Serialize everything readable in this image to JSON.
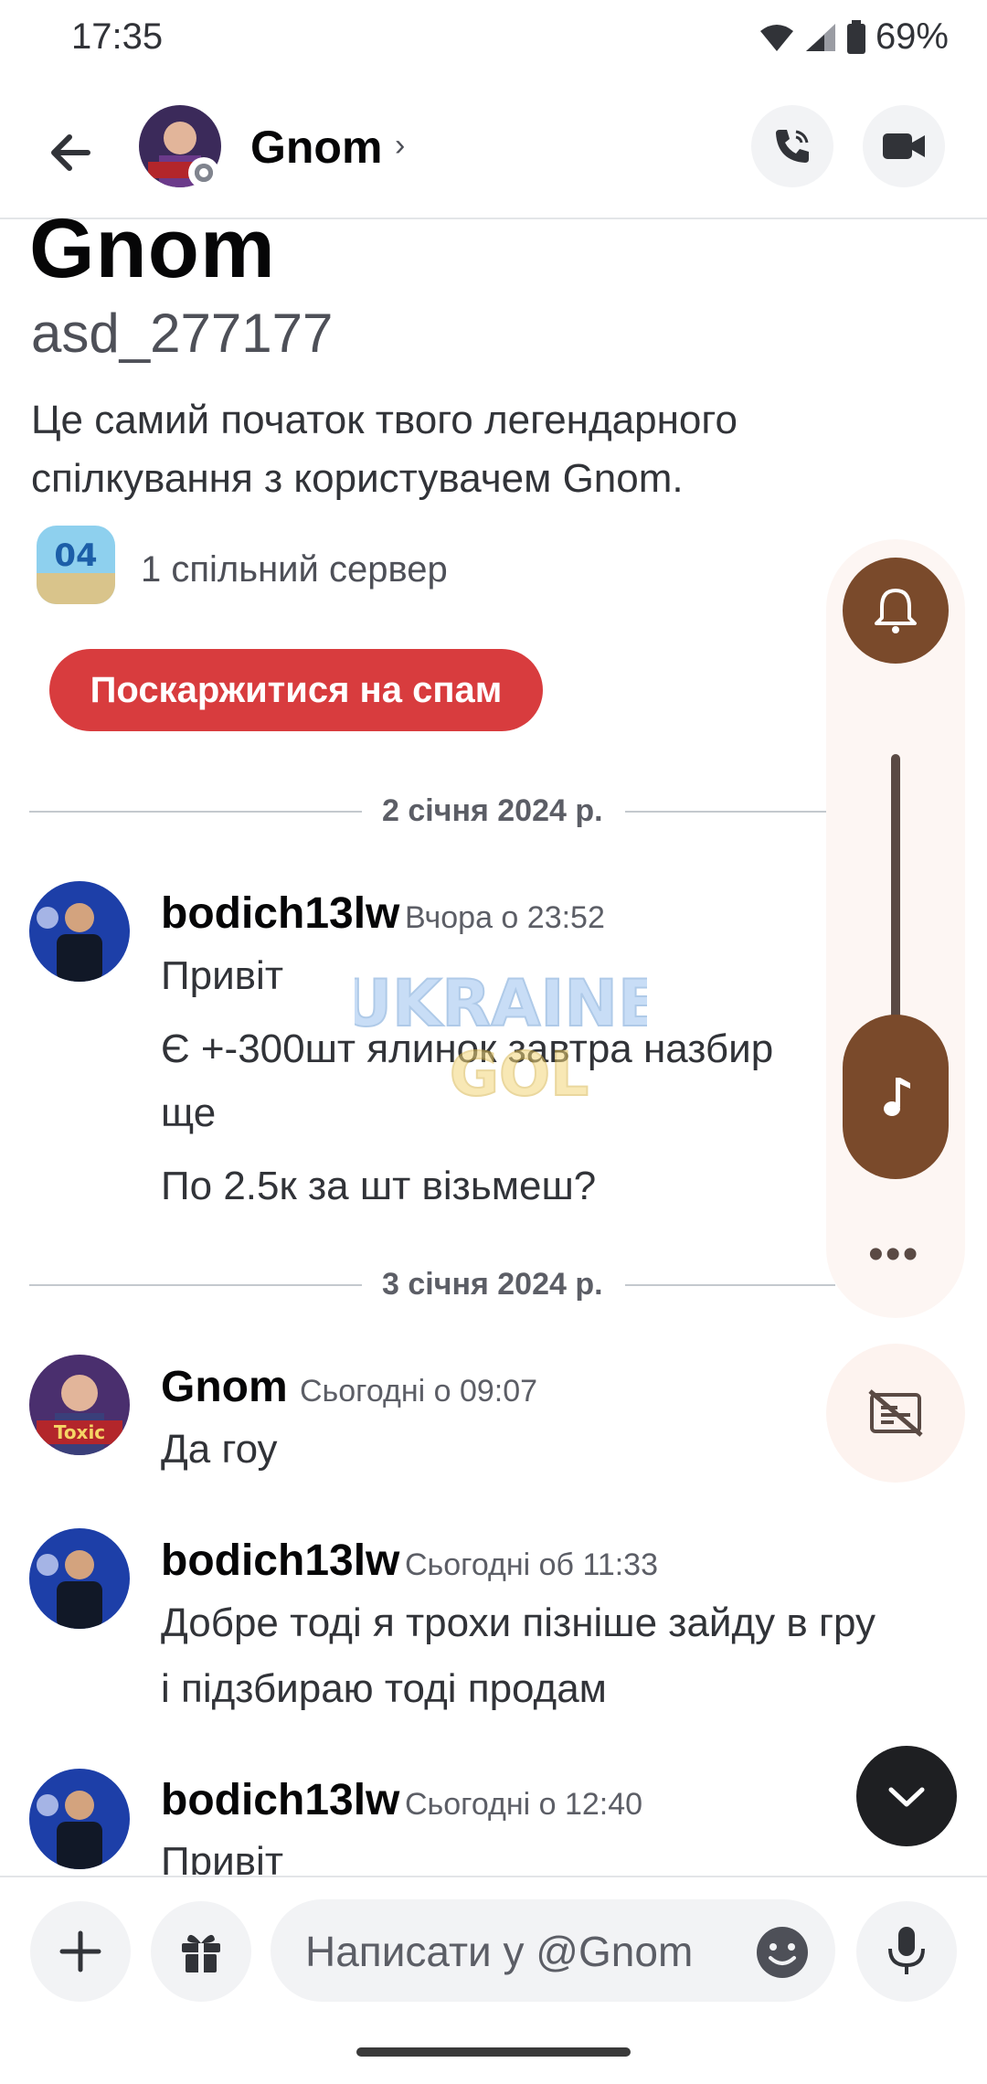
{
  "status_bar": {
    "time": "17:35",
    "battery": "69%"
  },
  "header": {
    "name": "Gnom",
    "chevron": "›",
    "back_icon": "arrow-left",
    "call_icon": "phone",
    "video_icon": "video-camera"
  },
  "profile": {
    "display_name": "Gnom",
    "username": "asd_277177",
    "intro": "Це самий початок твого легендарного спілкування з користувачем Gnom.",
    "mutual_servers": "1 спільний сервер",
    "server_icon_text": "04",
    "spam_button": "Поскаржитися на спам"
  },
  "watermark": {
    "line1": "UKRAINE",
    "line2": "GOL"
  },
  "dates": [
    "2 січня 2024 р.",
    "3 січня 2024 р."
  ],
  "messages": [
    {
      "author": "bodich13lw",
      "time": "Вчора о 23:52",
      "lines": [
        "Привіт",
        "Є +-300шт ялинок завтра назбир",
        "ще",
        "По 2.5к за шт візьмеш?"
      ]
    },
    {
      "author": "Gnom",
      "time": "Сьогодні о 09:07",
      "lines": [
        "Да гоу"
      ],
      "avatar_badge": "Toxic"
    },
    {
      "author": "bodich13lw",
      "time": "Сьогодні об 11:33",
      "lines": [
        "Добре тоді я трохи пізніше зайду в гру",
        "і підзбираю тоді продам"
      ]
    },
    {
      "author": "bodich13lw",
      "time": "Сьогодні о 12:40",
      "lines": [
        "Привіт"
      ]
    }
  ],
  "side_panel": {
    "dots": "•••",
    "icons": [
      "bell-icon",
      "music-note-icon",
      "captions-off-icon"
    ]
  },
  "composer": {
    "placeholder": "Написати у @Gnom"
  },
  "colors": {
    "spam": "#d83c3e",
    "panel_accent": "#7a4a2b",
    "panel_bg": "#fdf6f3"
  }
}
